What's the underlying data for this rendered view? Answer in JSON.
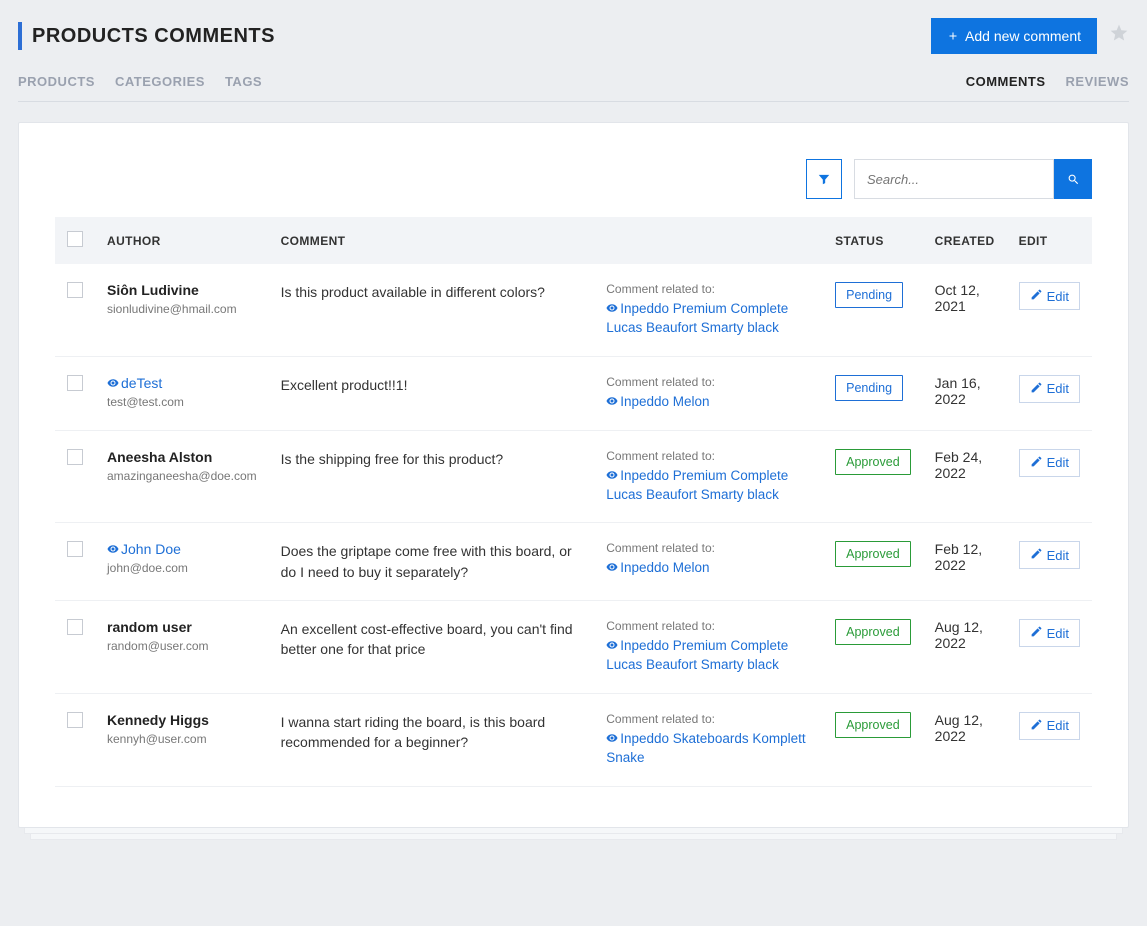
{
  "header": {
    "title": "PRODUCTS COMMENTS",
    "add_button": "Add new comment"
  },
  "tabs_left": [
    {
      "key": "products",
      "label": "PRODUCTS",
      "active": false
    },
    {
      "key": "categories",
      "label": "CATEGORIES",
      "active": false
    },
    {
      "key": "tags",
      "label": "TAGS",
      "active": false
    }
  ],
  "tabs_right": [
    {
      "key": "comments",
      "label": "COMMENTS",
      "active": true
    },
    {
      "key": "reviews",
      "label": "REVIEWS",
      "active": false
    }
  ],
  "search": {
    "placeholder": "Search..."
  },
  "columns": {
    "author": "AUTHOR",
    "comment": "COMMENT",
    "status": "STATUS",
    "created": "CREATED",
    "edit": "EDIT"
  },
  "labels": {
    "related_to": "Comment related to:",
    "edit": "Edit"
  },
  "statuses": {
    "pending": "Pending",
    "approved": "Approved"
  },
  "rows": [
    {
      "author": "Siôn Ludivine",
      "author_linked": false,
      "email": "sionludivine@hmail.com",
      "comment": "Is this product available in different colors?",
      "related": "Inpeddo Premium Complete Lucas Beaufort Smarty black",
      "status": "pending",
      "created": "Oct 12, 2021"
    },
    {
      "author": "deTest",
      "author_linked": true,
      "email": "test@test.com",
      "comment": "Excellent product!!1!",
      "related": "Inpeddo Melon",
      "status": "pending",
      "created": "Jan 16, 2022"
    },
    {
      "author": "Aneesha Alston",
      "author_linked": false,
      "email": "amazinganeesha@doe.com",
      "comment": "Is the shipping free for this product?",
      "related": "Inpeddo Premium Complete Lucas Beaufort Smarty black",
      "status": "approved",
      "created": "Feb 24, 2022"
    },
    {
      "author": "John Doe",
      "author_linked": true,
      "email": "john@doe.com",
      "comment": "Does the griptape come free with this board, or do I need to buy it separately?",
      "related": "Inpeddo Melon",
      "status": "approved",
      "created": "Feb 12, 2022"
    },
    {
      "author": "random user",
      "author_linked": false,
      "email": "random@user.com",
      "comment": "An excellent cost-effective board, you can't find better one for that price",
      "related": "Inpeddo Premium Complete Lucas Beaufort Smarty black",
      "status": "approved",
      "created": "Aug 12, 2022"
    },
    {
      "author": "Kennedy Higgs",
      "author_linked": false,
      "email": "kennyh@user.com",
      "comment": "I wanna start riding the board, is this board recommended for a beginner?",
      "related": "Inpeddo Skateboards Komplett Snake",
      "status": "approved",
      "created": "Aug 12, 2022"
    }
  ]
}
